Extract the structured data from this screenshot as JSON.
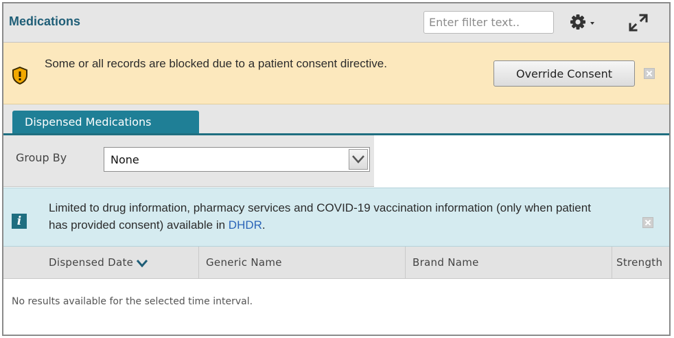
{
  "header": {
    "title": "Medications",
    "filter_placeholder": "Enter filter text..",
    "settings_icon": "gear-icon",
    "expand_icon": "expand-icon"
  },
  "consent_banner": {
    "message": "Some or all records are blocked due to a patient consent directive.",
    "override_label": "Override Consent",
    "icon": "shield-warning-icon",
    "background": "#fce8bd"
  },
  "tabs": [
    {
      "label": "Dispensed Medications",
      "active": true
    }
  ],
  "group_by": {
    "label": "Group By",
    "selected": "None"
  },
  "info_banner": {
    "message": "Limited to drug information, pharmacy services and COVID-19 vaccination information (only when patient has provided consent) available in",
    "link_text": "DHDR",
    "trailing": ".",
    "icon": "info-icon",
    "background": "#d5ebf0"
  },
  "table": {
    "columns": [
      {
        "label": "Dispensed Date",
        "sorted": "desc"
      },
      {
        "label": "Generic Name"
      },
      {
        "label": "Brand Name"
      },
      {
        "label": "Strength"
      }
    ],
    "empty_message": "No results available for the selected time interval."
  },
  "colors": {
    "accent": "#1f7f96",
    "title": "#1f5e77",
    "link": "#2a64b8"
  }
}
